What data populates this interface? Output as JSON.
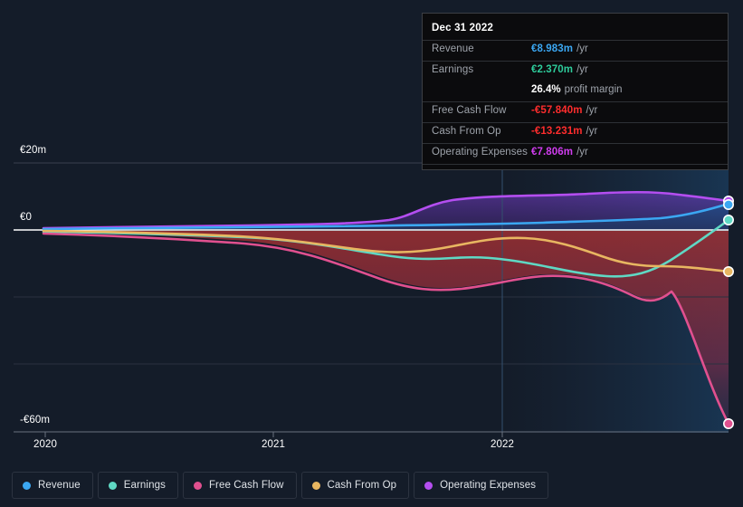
{
  "chart_data": {
    "type": "area",
    "title": "",
    "xlabel": "",
    "ylabel": "",
    "currency": "EUR",
    "units": "millions per year",
    "xticks": [
      "2020",
      "2021",
      "2022"
    ],
    "yticks": [
      "€20m",
      "€0",
      "-€60m"
    ],
    "ylim": [
      -60,
      20
    ],
    "xlim": [
      "2019-09",
      "2022-12"
    ],
    "grid": true,
    "legend_position": "bottom",
    "zero_line": true,
    "series": [
      {
        "name": "Revenue",
        "color": "#3ba7f2",
        "x": [
          "2019-12",
          "2020-06",
          "2020-12",
          "2021-06",
          "2021-12",
          "2022-06",
          "2022-12"
        ],
        "values": [
          0.6,
          0.7,
          0.9,
          1.1,
          1.4,
          3.2,
          8.983
        ]
      },
      {
        "name": "Earnings",
        "color": "#5fd8c4",
        "x": [
          "2019-12",
          "2020-06",
          "2020-12",
          "2021-06",
          "2021-12",
          "2022-06",
          "2022-12"
        ],
        "values": [
          -0.3,
          -0.5,
          -1.2,
          -3.4,
          -5.6,
          -9.0,
          2.37
        ]
      },
      {
        "name": "Free Cash Flow",
        "color": "#e0508f",
        "x": [
          "2019-12",
          "2020-06",
          "2020-12",
          "2021-06",
          "2021-12",
          "2022-06",
          "2022-12"
        ],
        "values": [
          -1.2,
          -2.4,
          -7.8,
          -14.5,
          -12.0,
          -16.8,
          -57.84
        ]
      },
      {
        "name": "Cash From Op",
        "color": "#e8b661",
        "x": [
          "2019-12",
          "2020-06",
          "2020-12",
          "2021-06",
          "2021-12",
          "2022-06",
          "2022-12"
        ],
        "values": [
          -0.6,
          -1.1,
          -2.6,
          -3.6,
          -2.1,
          -7.5,
          -13.231
        ]
      },
      {
        "name": "Operating Expenses",
        "color": "#b44ef0",
        "x": [
          "2019-12",
          "2020-06",
          "2020-12",
          "2021-06",
          "2021-12",
          "2022-06",
          "2022-12"
        ],
        "values": [
          0.9,
          1.0,
          1.2,
          1.5,
          5.8,
          8.9,
          7.806
        ]
      }
    ]
  },
  "axis": {
    "y": [
      {
        "label": "€20m",
        "top": 162
      },
      {
        "label": "€0",
        "top": 234
      },
      {
        "label": "-€60m",
        "top": 458
      }
    ],
    "x": [
      {
        "label": "2020",
        "left": 50
      },
      {
        "label": "2021",
        "left": 302
      },
      {
        "label": "2022",
        "left": 555
      }
    ]
  },
  "tooltip": {
    "date": "Dec 31 2022",
    "rows": [
      {
        "label": "Revenue",
        "value": "€8.983m",
        "unit": "/yr",
        "color": "#3ba7f2"
      },
      {
        "label": "Earnings",
        "value": "€2.370m",
        "unit": "/yr",
        "color": "#2ecc9b"
      },
      {
        "label": "Free Cash Flow",
        "value": "-€57.840m",
        "unit": "/yr",
        "color": "#ff2d2d"
      },
      {
        "label": "Cash From Op",
        "value": "-€13.231m",
        "unit": "/yr",
        "color": "#ff2d2d"
      },
      {
        "label": "Operating Expenses",
        "value": "€7.806m",
        "unit": "/yr",
        "color": "#d13df0"
      }
    ],
    "margin": {
      "value": "26.4%",
      "label": "profit margin"
    }
  },
  "legend": {
    "items": [
      {
        "label": "Revenue",
        "color": "#3ba7f2"
      },
      {
        "label": "Earnings",
        "color": "#5fd8c4"
      },
      {
        "label": "Free Cash Flow",
        "color": "#e0508f"
      },
      {
        "label": "Cash From Op",
        "color": "#e8b661"
      },
      {
        "label": "Operating Expenses",
        "color": "#b44ef0"
      }
    ]
  }
}
